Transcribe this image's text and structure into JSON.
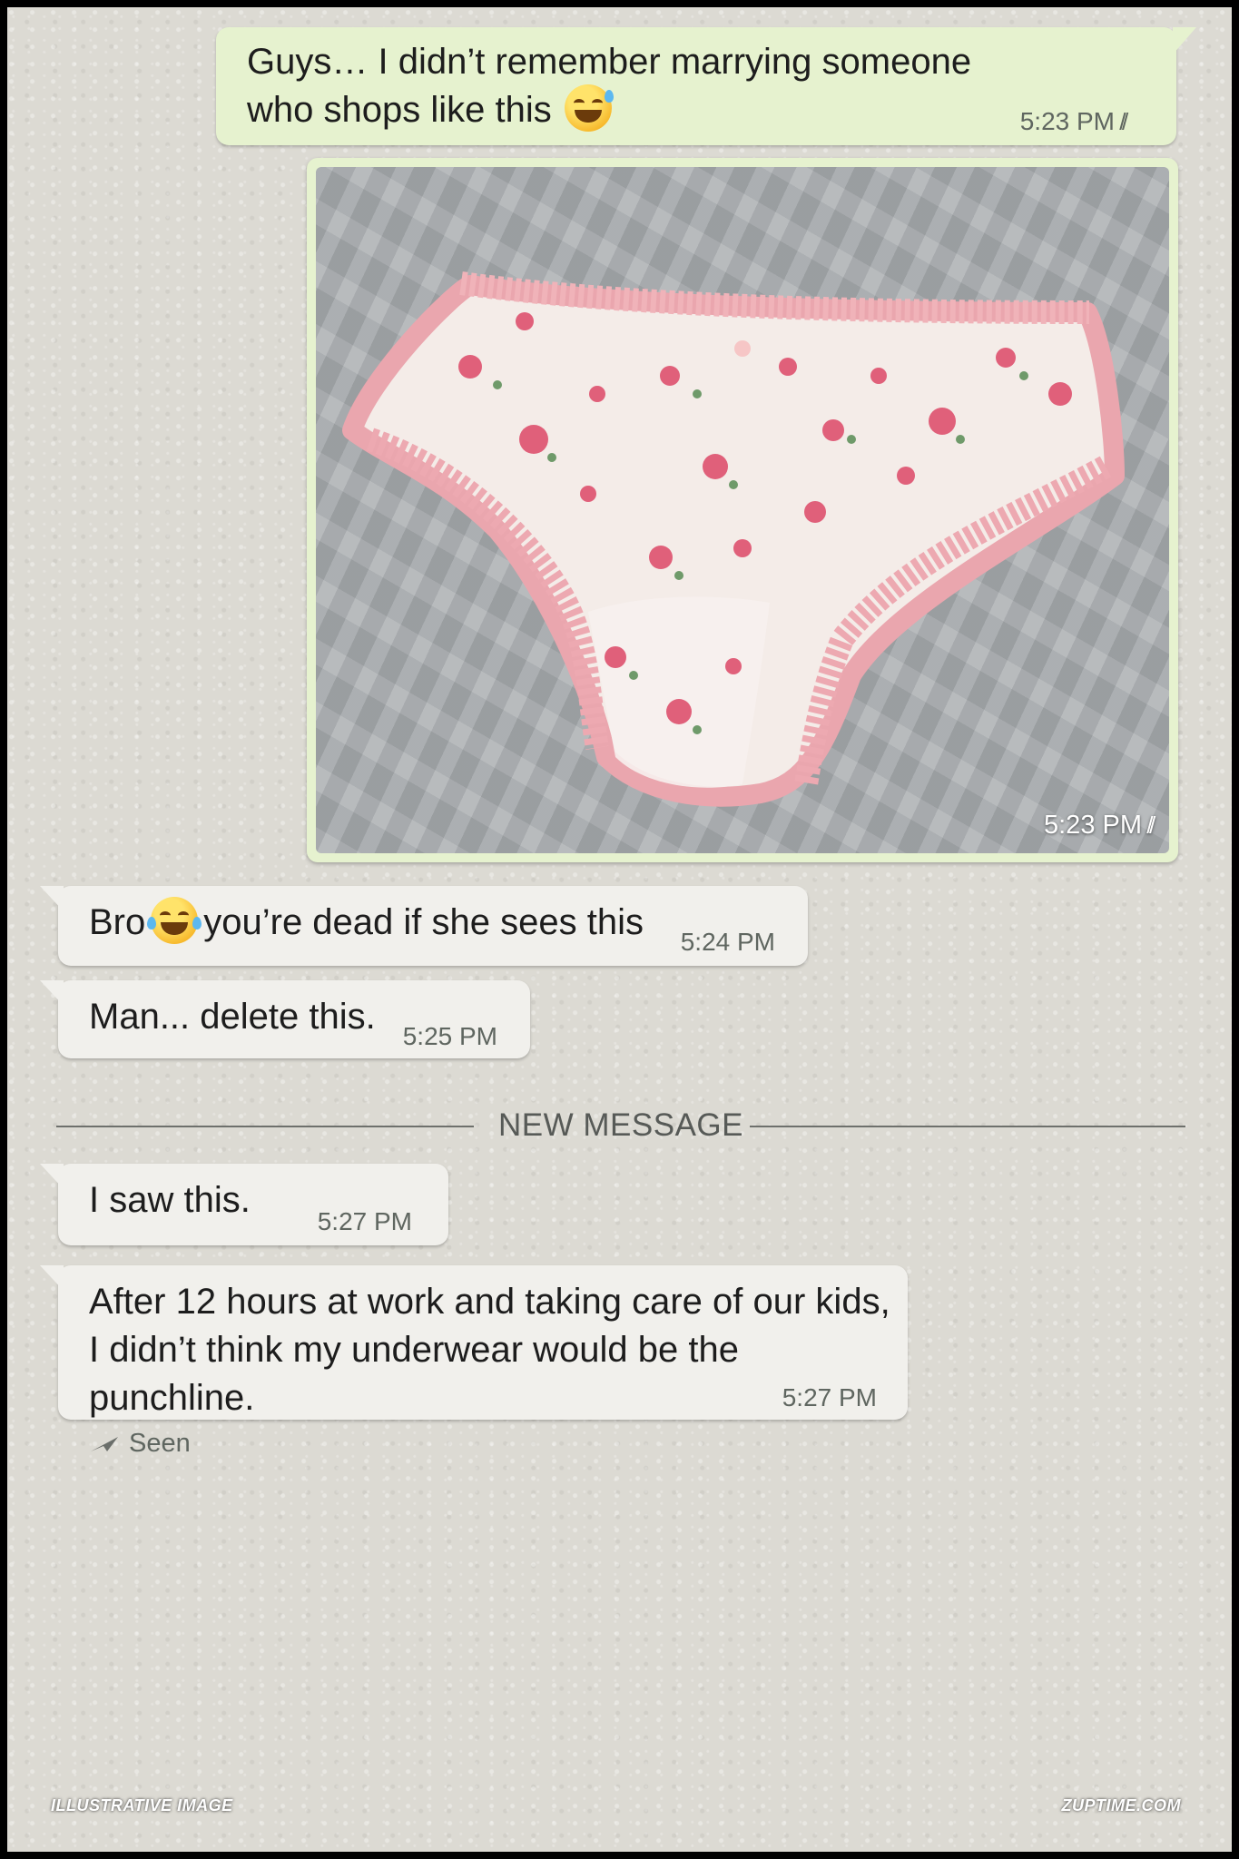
{
  "messages": [
    {
      "id": "m1",
      "direction": "outgoing",
      "line1": "Guys… I didn’t remember marrying someone",
      "line2": "who shops like this",
      "emoji": "sweat-smile-emoji",
      "time": "5:23 PM",
      "status": "read"
    },
    {
      "id": "m2",
      "direction": "outgoing",
      "type": "photo",
      "photo_subject": "floral-underwear-photo",
      "time": "5:23 PM",
      "status": "read"
    },
    {
      "id": "m3",
      "direction": "incoming",
      "text_before": "Bro",
      "emoji": "tears-of-joy-emoji",
      "text_after": "you’re dead if she sees this",
      "time": "5:24 PM"
    },
    {
      "id": "m4",
      "direction": "incoming",
      "text": "Man... delete this.",
      "time": "5:25 PM"
    },
    {
      "id": "m5",
      "direction": "incoming",
      "text": "I saw this.",
      "time": "5:27 PM"
    },
    {
      "id": "m6",
      "direction": "incoming",
      "line1": "After 12 hours at work and taking care of our kids,",
      "line2": "I didn’t think my underwear would be the punchline.",
      "time": "5:27 PM"
    }
  ],
  "divider": {
    "label": "NEW MESSAGE"
  },
  "seen": {
    "label": "Seen",
    "icon": "paper-plane-icon"
  },
  "footer": {
    "left": "ILLUSTRATIVE IMAGE",
    "right": "ZUPTIME.COM"
  },
  "colors": {
    "outgoing_bubble": "#e6f2cf",
    "incoming_bubble": "#f1f0ec",
    "background": "#dcdad3"
  }
}
